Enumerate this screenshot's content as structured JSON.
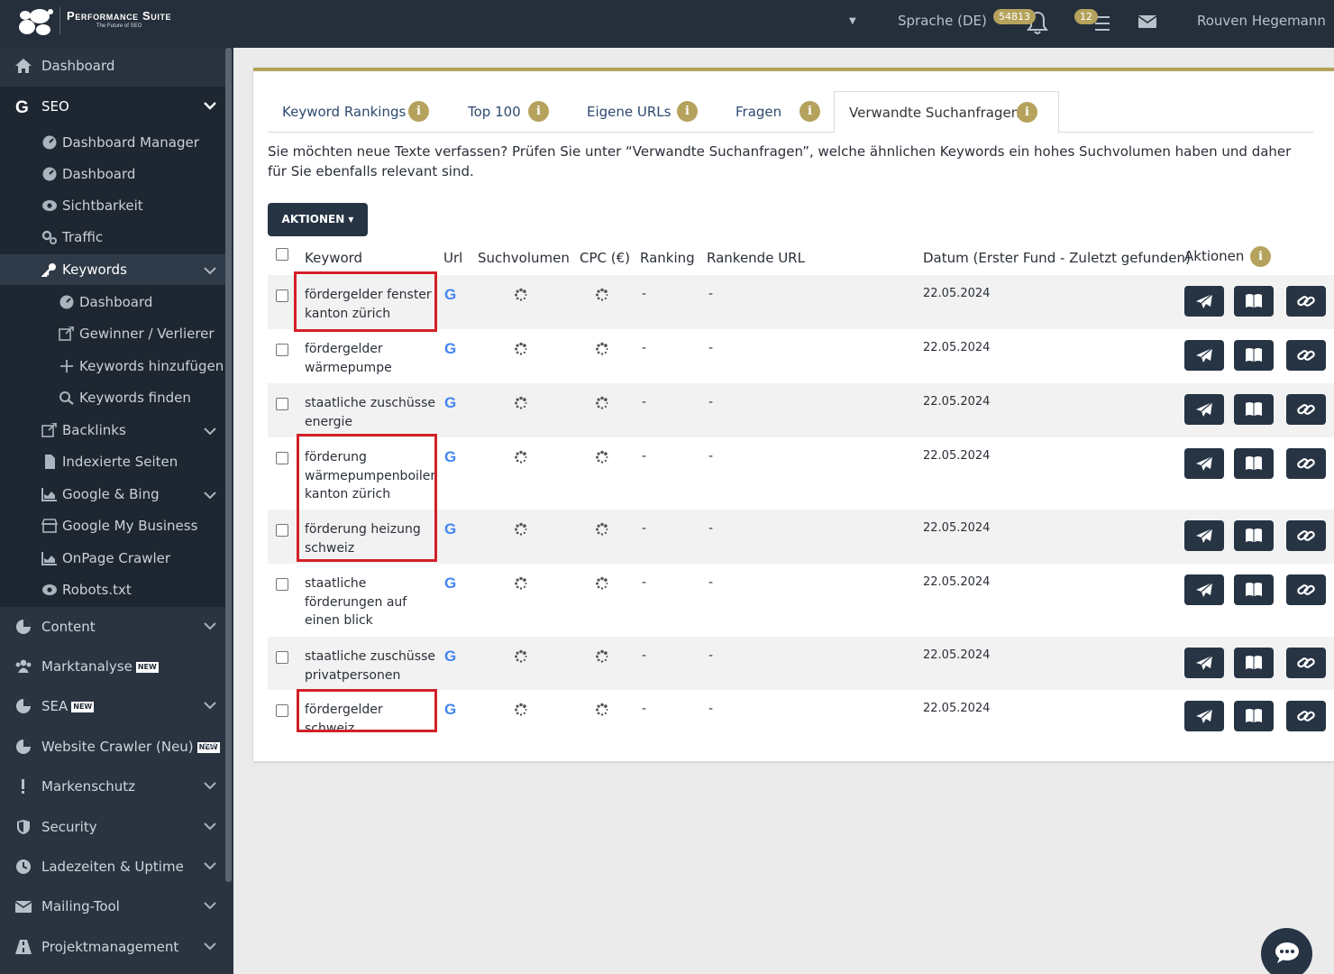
{
  "brand": {
    "title": "Performance Suite",
    "tagline": "The Future of SEO"
  },
  "header": {
    "language": "Sprache (DE)",
    "bell_count": "54813",
    "task_count": "12",
    "user": "Rouven Hegemann"
  },
  "sidebar": {
    "dashboard": "Dashboard",
    "seo": "SEO",
    "seo_items": {
      "dashboard_manager": "Dashboard Manager",
      "dashboard": "Dashboard",
      "sichtbarkeit": "Sichtbarkeit",
      "traffic": "Traffic",
      "keywords": "Keywords",
      "kw_dashboard": "Dashboard",
      "gewinner": "Gewinner / Verlierer",
      "kw_add": "Keywords hinzufügen",
      "kw_find": "Keywords finden",
      "backlinks": "Backlinks",
      "indexiert": "Indexierte Seiten",
      "google_bing": "Google & Bing",
      "gmb": "Google My Business",
      "onpage": "OnPage Crawler",
      "robots": "Robots.txt"
    },
    "content": "Content",
    "marktanalyse": "Marktanalyse",
    "sea": "SEA",
    "website_crawler": "Website Crawler (Neu)",
    "markenschutz": "Markenschutz",
    "security": "Security",
    "ladezeiten": "Ladezeiten & Uptime",
    "mailing": "Mailing-Tool",
    "projekt": "Projektmanagement",
    "new_label": "NEW"
  },
  "tabs": [
    "Keyword Rankings",
    "Top 100",
    "Eigene URLs",
    "Fragen",
    "Verwandte Suchanfragen"
  ],
  "intro": "Sie möchten neue Texte verfassen? Prüfen Sie unter “Verwandte Suchanfragen”, welche ähnlichen Keywords ein hohes Suchvolumen haben und daher für Sie ebenfalls relevant sind.",
  "actions_button": "AKTIONEN ▾",
  "table": {
    "headers": {
      "keyword": "Keyword",
      "url": "Url",
      "volume": "Suchvolumen",
      "cpc": "CPC (€)",
      "ranking": "Ranking",
      "ranking_url": "Rankende URL",
      "date": "Datum (Erster Fund - Zuletzt gefunden)",
      "actions": "Aktionen"
    },
    "rows": [
      {
        "keyword": "fördergelder fenster kanton zürich",
        "ranking": "-",
        "ranking_url": "-",
        "date": "22.05.2024"
      },
      {
        "keyword": "fördergelder wärmepumpe",
        "ranking": "-",
        "ranking_url": "-",
        "date": "22.05.2024"
      },
      {
        "keyword": "staatliche zuschüsse energie",
        "ranking": "-",
        "ranking_url": "-",
        "date": "22.05.2024"
      },
      {
        "keyword": "förderung wärmepumpenboiler kanton zürich",
        "ranking": "-",
        "ranking_url": "-",
        "date": "22.05.2024"
      },
      {
        "keyword": "förderung heizung schweiz",
        "ranking": "-",
        "ranking_url": "-",
        "date": "22.05.2024"
      },
      {
        "keyword": "staatliche förderungen auf einen blick",
        "ranking": "-",
        "ranking_url": "-",
        "date": "22.05.2024"
      },
      {
        "keyword": "staatliche zuschüsse privatpersonen",
        "ranking": "-",
        "ranking_url": "-",
        "date": "22.05.2024"
      },
      {
        "keyword": "fördergelder schweiz",
        "ranking": "-",
        "ranking_url": "-",
        "date": "22.05.2024"
      }
    ]
  },
  "colors": {
    "accent": "#b5a25c",
    "dark": "#263444",
    "highlight": "#d32027",
    "google_blue": "#4285f4"
  }
}
